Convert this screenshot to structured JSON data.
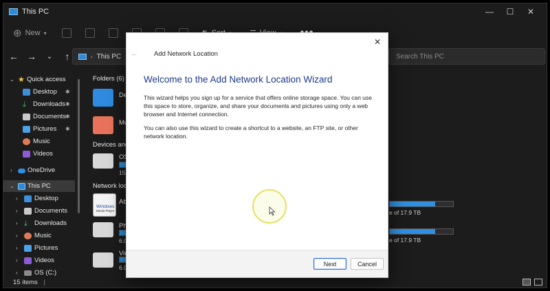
{
  "window": {
    "title": "This PC",
    "controls": [
      "—",
      "☐",
      "✕"
    ]
  },
  "cmdbar": {
    "new_label": "New",
    "sort_label": "Sort",
    "view_label": "View",
    "more_label": "•••"
  },
  "address": {
    "path": "This PC",
    "search_placeholder": "Search This PC"
  },
  "sidebar": {
    "quick_access": "Quick access",
    "qa_items": [
      "Desktop",
      "Downloads",
      "Documents",
      "Pictures",
      "Music",
      "Videos"
    ],
    "onedrive": "OneDrive",
    "this_pc": "This PC",
    "pc_items": [
      "Desktop",
      "Documents",
      "Downloads",
      "Music",
      "Pictures",
      "Videos",
      "OS (C:)"
    ]
  },
  "content": {
    "folders_header": "Folders (6)",
    "folder_names": [
      "Desk",
      "Mus"
    ],
    "devices_header": "Devices and d",
    "device_name": "OS (",
    "device_size": "159",
    "network_header": "Network loca",
    "net_items": [
      {
        "name": "Abb",
        "badge_line1": "Windows",
        "badge_line2": "Media Player"
      },
      {
        "name": "Pho",
        "size": "6.07"
      },
      {
        "name": "Vide",
        "size": "6.07"
      }
    ],
    "drive_suffix_1": "e of 17.9 TB",
    "drive_suffix_2": "e of 17.9 TB",
    "drive_fill_1": 0.72,
    "drive_fill_2": 0.72
  },
  "status": {
    "items_count": "15 items",
    "separator": "|"
  },
  "dialog": {
    "title": "Add Network Location",
    "heading": "Welcome to the Add Network Location Wizard",
    "para1": "This wizard helps you sign up for a service that offers online storage space.  You can use this space to store, organize, and share your documents and pictures using only a web browser and Internet connection.",
    "para2": "You can also use this wizard to create a shortcut to a website, an FTP site, or other network location.",
    "next_label": "Next",
    "cancel_label": "Cancel"
  }
}
